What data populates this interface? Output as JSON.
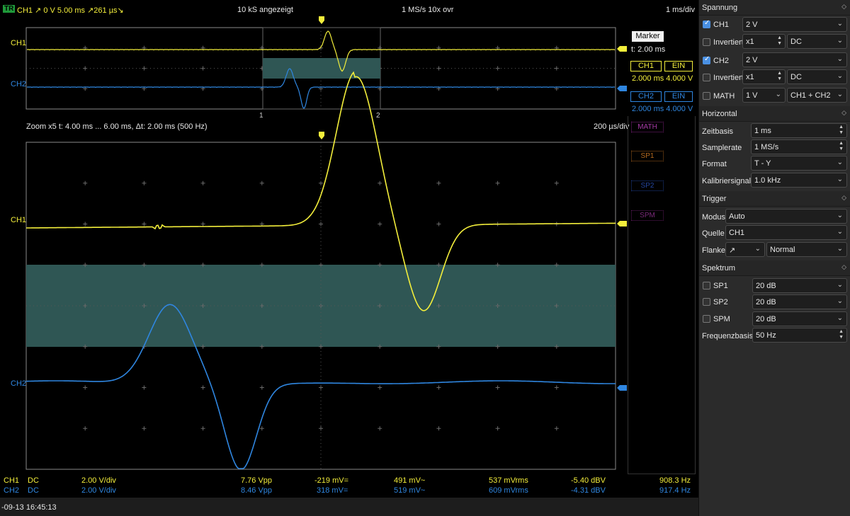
{
  "topbar": {
    "trig_badge": "TR",
    "trig_info": "CH1  ↗  0 V  5.00 ms ↗261 µs↘",
    "samples": "10 kS angezeigt",
    "samplerate": "1 MS/s 10x ovr",
    "timebase": "1 ms/div"
  },
  "overview": {
    "ch1_label": "CH1",
    "ch2_label": "CH2",
    "marker1": "1",
    "marker2": "2"
  },
  "zoom": {
    "info": "Zoom x5   t: 4.00 ms ... 6.00 ms,  Δt: 2.00 ms (500 Hz)",
    "div": "200 µs/div",
    "ch1_label": "CH1",
    "ch2_label": "CH2"
  },
  "side_buttons": {
    "math": "MATH",
    "sp1": "SP1",
    "sp2": "SP2",
    "spm": "SPM"
  },
  "marker_panel": {
    "title": "Marker",
    "t": "t: 2.00 ms",
    "ch1": "CH1",
    "ch1_state": "EIN",
    "ch1_vals": "2.000 ms 4.000 V",
    "ch2": "CH2",
    "ch2_state": "EIN",
    "ch2_vals": "2.000 ms 4.000 V"
  },
  "measurements": [
    {
      "ch": "CH1",
      "coupling": "DC",
      "vdiv": "2.00 V/div",
      "vpp": "7.76 Vpp",
      "mean": "-219 mV=",
      "ac": "491 mV~",
      "rms": "537 mVrms",
      "dbv": "-5.40 dBV",
      "freq": "908.3 Hz"
    },
    {
      "ch": "CH2",
      "coupling": "DC",
      "vdiv": "2.00 V/div",
      "vpp": "8.46 Vpp",
      "mean": "318 mV=",
      "ac": "519 mV~",
      "rms": "609 mVrms",
      "dbv": "-4.31 dBV",
      "freq": "917.4 Hz"
    }
  ],
  "footer": {
    "datetime": "-09-13 16:45:13"
  },
  "panel": {
    "spannung": {
      "title": "Spannung",
      "ch1": {
        "label": "CH1",
        "value": "2 V"
      },
      "inv1": {
        "label": "Invertiert",
        "probe": "x1",
        "coupling": "DC"
      },
      "ch2": {
        "label": "CH2",
        "value": "2 V"
      },
      "inv2": {
        "label": "Invertiert",
        "probe": "x1",
        "coupling": "DC"
      },
      "math": {
        "label": "MATH",
        "value": "1 V",
        "op": "CH1 + CH2"
      }
    },
    "horizontal": {
      "title": "Horizontal",
      "zeitbasis_label": "Zeitbasis",
      "zeitbasis": "1 ms",
      "samplerate_label": "Samplerate",
      "samplerate": "1 MS/s",
      "format_label": "Format",
      "format": "T - Y",
      "kal_label": "Kalibriersignal",
      "kal": "1.0 kHz"
    },
    "trigger": {
      "title": "Trigger",
      "modus_label": "Modus",
      "modus": "Auto",
      "quelle_label": "Quelle",
      "quelle": "CH1",
      "flanke_label": "Flanke",
      "flanke": "↗",
      "flanke_mode": "Normal"
    },
    "spektrum": {
      "title": "Spektrum",
      "sp1_label": "SP1",
      "sp1": "20 dB",
      "sp2_label": "SP2",
      "sp2": "20 dB",
      "spm_label": "SPM",
      "spm": "20 dB",
      "fb_label": "Frequenzbasis",
      "fb": "50 Hz"
    }
  },
  "colors": {
    "ch1": "#f3ee3b",
    "ch2": "#2f86e0",
    "cursor_band": "#2f5654",
    "trigger_marker": "#f3ee3b"
  }
}
